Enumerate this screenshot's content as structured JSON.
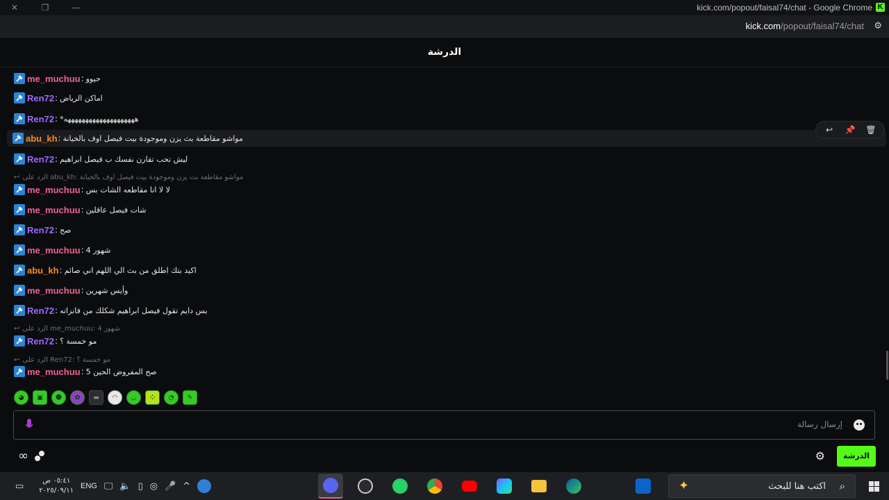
{
  "window": {
    "title": "kick.com/popout/faisal74/chat - Google Chrome",
    "url_host": "kick.com",
    "url_path": "/popout/faisal74/chat"
  },
  "chat": {
    "header": "الدرشة",
    "messages": [
      {
        "user": "me_muchuu",
        "text": "حيوو"
      },
      {
        "user": "Ren72",
        "text": "اماكن الرياض"
      },
      {
        "user": "Ren72",
        "text": "*ههههههههههههههههههههه"
      },
      {
        "user": "abu_kh",
        "text": "مواشو مقاطعة بث يزن وموجودة بيت فيصل اوف بالخيانة"
      },
      {
        "user": "Ren72",
        "text": "ليش تحب تقارن نفسك ب فيصل ابراهيم"
      },
      {
        "user": "me_muchuu",
        "text": "لا لا انا مقاطعه الشات بس"
      },
      {
        "user": "me_muchuu",
        "text": "شات فيصل عاقلين"
      },
      {
        "user": "Ren72",
        "text": "صح"
      },
      {
        "user": "me_muchuu",
        "text": "4 شهور"
      },
      {
        "user": "abu_kh",
        "text": "اكيد بتك اطلق من بث الي اللهم اني صائم"
      },
      {
        "user": "me_muchuu",
        "text": "وأيس شهرين"
      },
      {
        "user": "Ren72",
        "text": "بس دايم تقول فيصل ابراهيم شكلك من فانزاته"
      },
      {
        "user": "Ren72",
        "text": "مو خمسة ؟"
      },
      {
        "user": "me_muchuu",
        "text": "5 صح المفروض الحين"
      }
    ],
    "replies": [
      "الرد على abu_kh: مواشو مقاطعة بث يزن وموجودة بيت فيصل اوف بالخيانة",
      "الرد على me_muchuu: 4 شهور",
      "الرد على Ren72: مو خمسة ؟"
    ],
    "input_placeholder": "إرسال رسالة",
    "send_button": "الدرشة"
  },
  "taskbar": {
    "time": "٠٥:٤١ ص",
    "date": "٢٠٢٥/٠٩/١١",
    "language": "ENG",
    "search_placeholder": "اكتب هنا للبحث"
  },
  "colors": {
    "kick_green": "#53fc18",
    "user_pink": "#f06292",
    "user_purple": "#9d6bff",
    "user_orange": "#ff8a1c",
    "badge_blue": "#2b85d6"
  }
}
